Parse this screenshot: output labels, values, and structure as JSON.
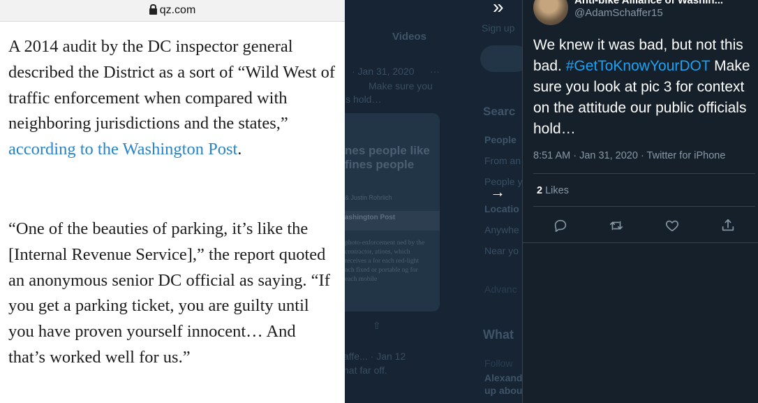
{
  "browser": {
    "url": "qz.com"
  },
  "article": {
    "p1_text": "A 2014 audit by the DC inspector general described the District as a sort of “Wild West of traffic enforcement when compared with neighboring jurisdictions and the states,” ",
    "p1_link": "according to the Washington Post",
    "p1_end": ".",
    "p2_text": "“One of the beauties of parking, it’s like the [Internal Revenue Service],” the report quoted an anonymous senior DC official as saying. “If you get a parking ticket, you are guilty until you have proven yourself innocent… And that’s worked well for us.”",
    "link_color": "#2a83c6"
  },
  "background": {
    "tab_videos": "Videos",
    "tweet1_date": "· Jan 31, 2020",
    "tweet1_more": "···",
    "tweet1_text_a": "Make sure you",
    "tweet1_text_b": "ls hold…",
    "card_headline": "nes people like fines people",
    "card_byline": "& Justin Rohrlich",
    "card_source": "ashington Post",
    "card_body": "photo-enforcement ned by the contractor, ations, which receives a for each red-light nch fixed or portable ng for each mobile",
    "tweet2_meta": "affe... · Jan 12",
    "tweet2_text": "hat far off.",
    "search_heading": "Searc",
    "people_label": "People",
    "from_anyone": "From an",
    "people_you": "People y",
    "location_label": "Locatio",
    "anywhere": "Anywhe",
    "near_you": "Near yo",
    "advanced": "Advanc",
    "whats": "What",
    "follow": "Follow",
    "alexand": "Alexand",
    "up_abou": "up abou",
    "signup": "Sign up"
  },
  "tweet": {
    "display_name": "Anti-bike Alliance of Washin...",
    "handle": "@AdamSchaffer15",
    "more_icon": "more-icon",
    "text_a": "We knew it was bad, but not this bad. ",
    "hashtag": "#GetToKnowYourDOT",
    "text_b": " Make sure you look at pic 3 for context on the attitude our public officials hold…",
    "timestamp": "8:51 AM · Jan 31, 2020 · Twitter for iPhone",
    "likes_count": "2",
    "likes_label": " Likes",
    "hashtag_color": "#1da1f2",
    "background_color": "#15202b"
  },
  "actions": [
    "reply-icon",
    "retweet-icon",
    "like-icon",
    "share-icon"
  ]
}
